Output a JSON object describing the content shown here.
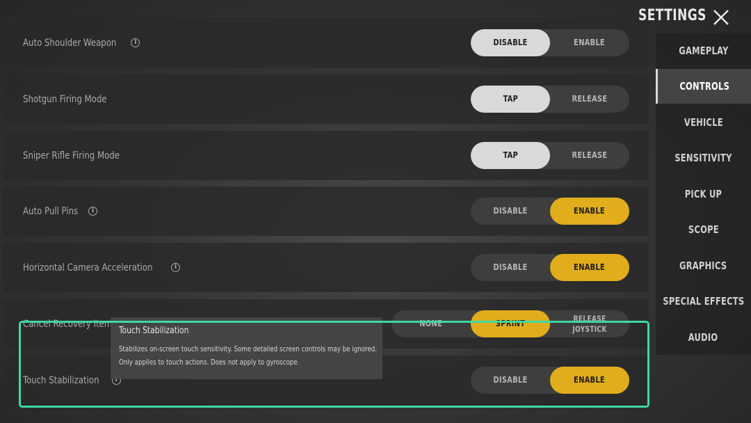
{
  "header": {
    "title": "SETTINGS",
    "close_icon": "close-icon"
  },
  "sidebar": {
    "items": [
      {
        "label": "GAMEPLAY",
        "active": false
      },
      {
        "label": "CONTROLS",
        "active": true
      },
      {
        "label": "VEHICLE",
        "active": false
      },
      {
        "label": "SENSITIVITY",
        "active": false
      },
      {
        "label": "PICK UP",
        "active": false
      },
      {
        "label": "SCOPE",
        "active": false
      },
      {
        "label": "GRAPHICS",
        "active": false
      },
      {
        "label": "SPECIAL EFFECTS",
        "active": false
      },
      {
        "label": "AUDIO",
        "active": false
      }
    ]
  },
  "settings": [
    {
      "label": "Auto Shoulder Weapon",
      "info": true,
      "options": [
        "DISABLE",
        "ENABLE"
      ],
      "selected": "DISABLE"
    },
    {
      "label": "Shotgun Firing Mode",
      "info": false,
      "options": [
        "TAP",
        "RELEASE"
      ],
      "selected": "TAP"
    },
    {
      "label": "Sniper Rifle Firing Mode",
      "info": false,
      "options": [
        "TAP",
        "RELEASE"
      ],
      "selected": "TAP"
    },
    {
      "label": "Auto Pull Pins",
      "info": true,
      "options": [
        "DISABLE",
        "ENABLE"
      ],
      "selected": "ENABLE"
    },
    {
      "label": "Horizontal Camera Acceleration",
      "info": true,
      "options": [
        "DISABLE",
        "ENABLE"
      ],
      "selected": "ENABLE"
    },
    {
      "label": "Cancel Recovery Item",
      "info": false,
      "options": [
        "NONE",
        "SPRINT",
        "RELEASE JOYSTICK"
      ],
      "selected": "SPRINT"
    },
    {
      "label": "Touch Stabilization",
      "info": true,
      "options": [
        "DISABLE",
        "ENABLE"
      ],
      "selected": "ENABLE"
    }
  ],
  "tooltip": {
    "title": "Touch Stabilization",
    "line1": "Stabilizes on-screen touch sensitivity. Some detailed screen controls may be ignored.",
    "line2": "Only applies to touch actions. Does not apply to gyroscope."
  },
  "colors": {
    "accent": "#e2ad1c",
    "highlight": "#3ed9a0",
    "selected_gray": "#d9d9d9"
  }
}
